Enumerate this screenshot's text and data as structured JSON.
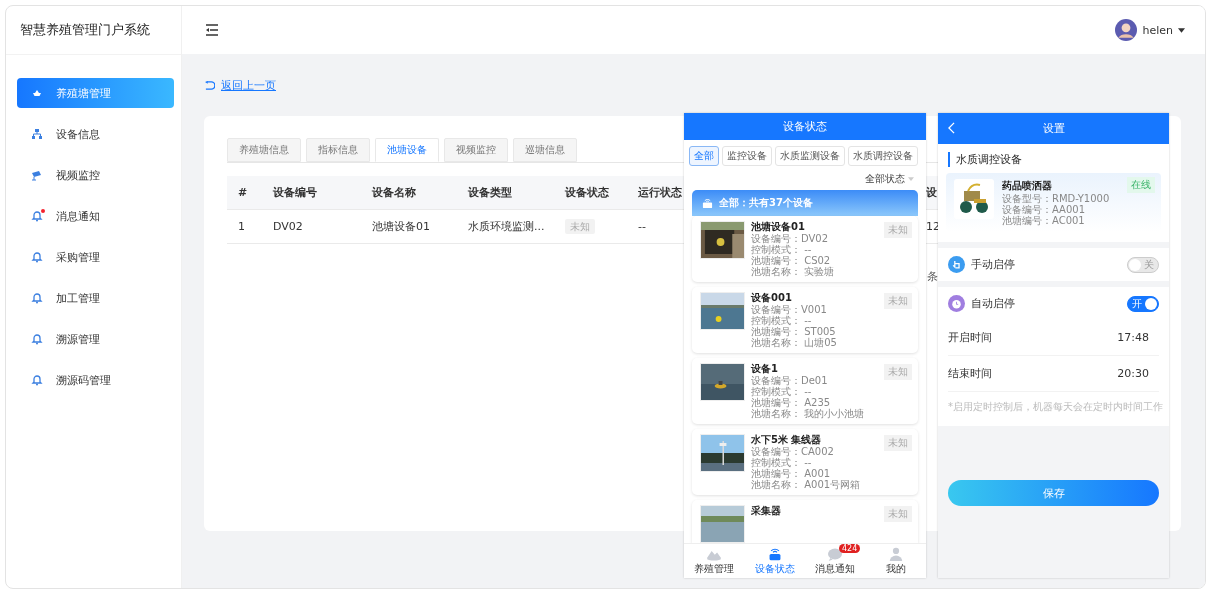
{
  "app": {
    "title": "智慧养殖管理门户系统",
    "user": "helen"
  },
  "sidebar": {
    "items": [
      {
        "label": "养殖塘管理",
        "selected": true,
        "dot": false
      },
      {
        "label": "设备信息",
        "selected": false,
        "dot": false
      },
      {
        "label": "视频监控",
        "selected": false,
        "dot": false
      },
      {
        "label": "消息通知",
        "selected": false,
        "dot": true
      },
      {
        "label": "采购管理",
        "selected": false,
        "dot": false
      },
      {
        "label": "加工管理",
        "selected": false,
        "dot": false
      },
      {
        "label": "溯源管理",
        "selected": false,
        "dot": false
      },
      {
        "label": "溯源码管理",
        "selected": false,
        "dot": false
      }
    ]
  },
  "back_link": "返回上一页",
  "tabs": [
    {
      "label": "养殖塘信息",
      "selected": false
    },
    {
      "label": "指标信息",
      "selected": false
    },
    {
      "label": "池塘设备",
      "selected": true
    },
    {
      "label": "视频监控",
      "selected": false
    },
    {
      "label": "巡塘信息",
      "selected": false
    }
  ],
  "table": {
    "columns": [
      "#",
      "设备编号",
      "设备名称",
      "设备类型",
      "设备状态",
      "运行状态",
      "设"
    ],
    "rows": [
      {
        "cells": [
          "1",
          "DV02",
          "池塘设备01",
          "水质环境监测...",
          "未知",
          "--",
          "12"
        ]
      }
    ]
  },
  "pagination": {
    "column_1": "条"
  },
  "status_screen": {
    "title": "设备状态",
    "filters": [
      {
        "label": "全部",
        "selected": true
      },
      {
        "label": "监控设备",
        "selected": false
      },
      {
        "label": "水质监测设备",
        "selected": false
      },
      {
        "label": "水质调控设备",
        "selected": false
      }
    ],
    "status_filter": "全部状态",
    "summary": "全部：共有37个设备",
    "devices": [
      {
        "name": "池塘设备01",
        "badge": "未知",
        "fields": [
          "设备编号：DV02",
          "控制模式： --",
          "池塘编号： CS02",
          "池塘名称： 实验塘"
        ]
      },
      {
        "name": "设备001",
        "badge": "未知",
        "fields": [
          "设备编号：V001",
          "控制模式： --",
          "池塘编号： ST005",
          "池塘名称： 山塘05"
        ]
      },
      {
        "name": "设备1",
        "badge": "未知",
        "fields": [
          "设备编号：De01",
          "控制模式： --",
          "池塘编号： A235",
          "池塘名称： 我的小小池塘"
        ]
      },
      {
        "name": "水下5米 集线器",
        "badge": "未知",
        "fields": [
          "设备编号：CA002",
          "控制模式： --",
          "池塘编号： A001",
          "池塘名称： A001号网箱"
        ]
      },
      {
        "name": "采集器",
        "badge": "未知"
      }
    ],
    "nav": [
      {
        "label": "养殖管理",
        "selected": false
      },
      {
        "label": "设备状态",
        "selected": true
      },
      {
        "label": "消息通知",
        "selected": false,
        "badge": "424"
      },
      {
        "label": "我的",
        "selected": false
      }
    ]
  },
  "settings_screen": {
    "title": "设置",
    "section": "水质调控设备",
    "device": {
      "name": "药品喷洒器",
      "status": "在线",
      "fields": [
        "设备型号：RMD-Y1000",
        "设备编号：AA001",
        "池塘编号：AC001"
      ]
    },
    "switches": [
      {
        "label": "手动启停",
        "on": false,
        "switch_text": "关"
      },
      {
        "label": "自动启停",
        "on": true,
        "switch_text": "开"
      }
    ],
    "times": [
      {
        "label": "开启时间",
        "value": "17:48"
      },
      {
        "label": "结束时间",
        "value": "20:30"
      }
    ],
    "note": "*启用定时控制后，机器每天会在定时内时间工作",
    "save": "保存"
  }
}
